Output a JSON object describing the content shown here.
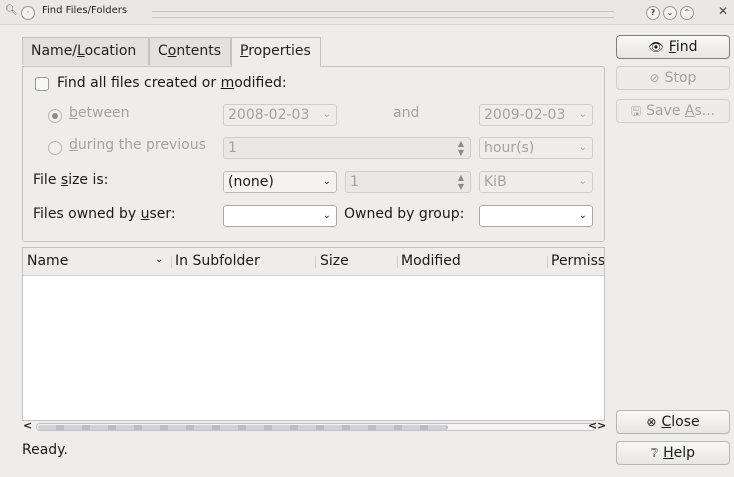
{
  "window": {
    "title": "Find Files/Folders"
  },
  "tabs": [
    {
      "label_pre": "Name/",
      "label_key": "L",
      "label_post": "ocation"
    },
    {
      "label_pre": "C",
      "label_key": "o",
      "label_post": "ntents"
    },
    {
      "label_pre": "",
      "label_key": "P",
      "label_post": "roperties"
    }
  ],
  "properties": {
    "find_all_pre": "Find all files created or ",
    "find_all_key": "m",
    "find_all_post": "odified:",
    "between_key": "b",
    "between_post": "etween",
    "date_from": "2008-02-03",
    "and_label": "and",
    "date_to": "2009-02-03",
    "during_key": "d",
    "during_post": "uring the previous",
    "previous_value": "1",
    "previous_unit": "hour(s)",
    "size_pre": "File ",
    "size_key": "s",
    "size_post": "ize is:",
    "size_mode": "(none)",
    "size_value": "1",
    "size_unit": "KiB",
    "owner_pre": "Files owned by ",
    "owner_key": "u",
    "owner_post": "ser:",
    "owner_value": "",
    "group_pre": "Owned by ",
    "group_key": "g",
    "group_post": "roup:",
    "group_value": ""
  },
  "results": {
    "columns": [
      "Name",
      "In Subfolder",
      "Size",
      "Modified",
      "Permiss"
    ]
  },
  "status": "Ready.",
  "buttons": {
    "find_key": "F",
    "find_post": "ind",
    "stop": "Stop",
    "save_pre": "Save ",
    "save_key": "A",
    "save_post": "s...",
    "close_key": "C",
    "close_post": "lose",
    "help_key": "H",
    "help_post": "elp"
  },
  "icons": {
    "app": "search-icon",
    "find": "binoculars-icon",
    "stop": "stop-icon",
    "save": "save-icon",
    "close": "close-icon",
    "help": "help-icon"
  }
}
